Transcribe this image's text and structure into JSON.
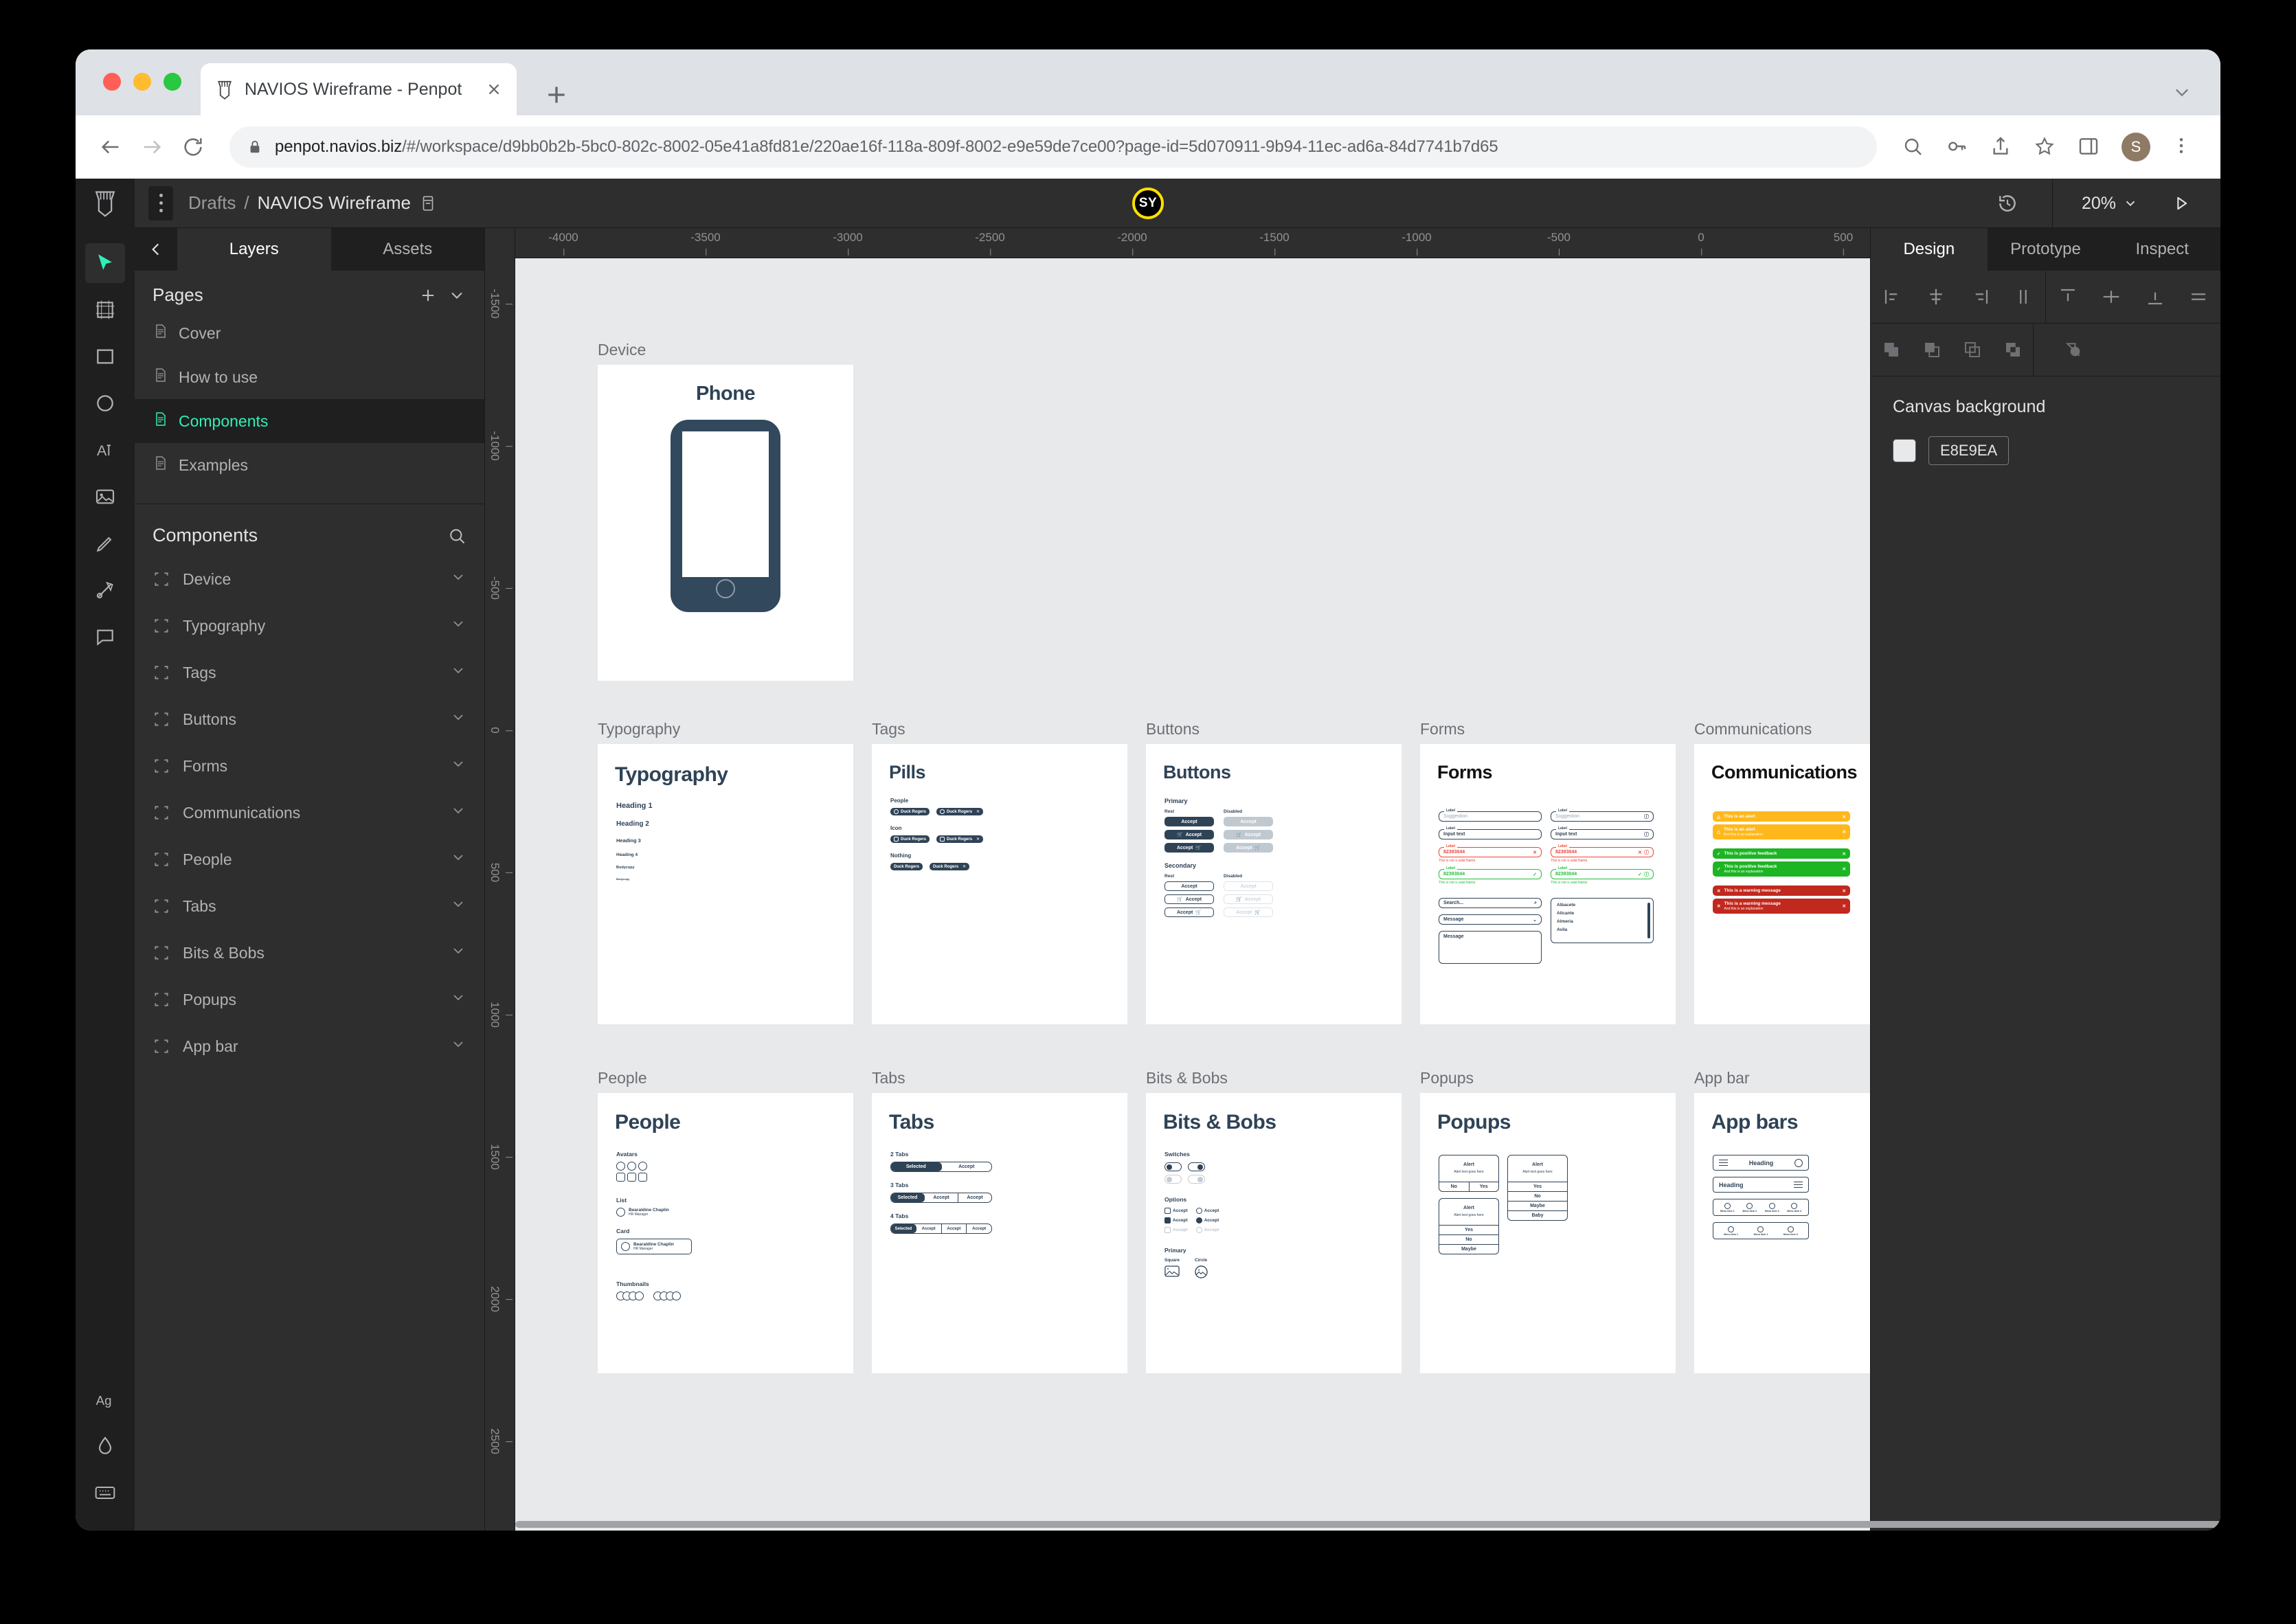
{
  "browser": {
    "tab_title": "NAVIOS Wireframe - Penpot",
    "url_host": "penpot.navios.biz",
    "url_path": "/#/workspace/d9bb0b2b-5bc0-802c-8002-05e41a8fd81e/220ae16f-118a-809f-8002-e9e59de7ce00?page-id=5d070911-9b94-11ec-ad6a-84d7741b7d65",
    "profile_initial": "S"
  },
  "header": {
    "breadcrumb_project": "Drafts",
    "breadcrumb_separator": "/",
    "breadcrumb_file": "NAVIOS Wireframe",
    "collaborator_initials": "SY",
    "zoom_level": "20%"
  },
  "left_panel": {
    "tabs": [
      {
        "label": "Layers",
        "active": true
      },
      {
        "label": "Assets",
        "active": false
      }
    ],
    "pages_title": "Pages",
    "pages": [
      {
        "label": "Cover",
        "selected": false
      },
      {
        "label": "How to use",
        "selected": false
      },
      {
        "label": "Components",
        "selected": true
      },
      {
        "label": "Examples",
        "selected": false
      }
    ],
    "components_title": "Components",
    "components": [
      {
        "label": "Device"
      },
      {
        "label": "Typography"
      },
      {
        "label": "Tags"
      },
      {
        "label": "Buttons"
      },
      {
        "label": "Forms"
      },
      {
        "label": "Communications"
      },
      {
        "label": "People"
      },
      {
        "label": "Tabs"
      },
      {
        "label": "Bits & Bobs"
      },
      {
        "label": "Popups"
      },
      {
        "label": "App bar"
      }
    ]
  },
  "right_panel": {
    "tabs": [
      {
        "label": "Design",
        "active": true
      },
      {
        "label": "Prototype",
        "active": false
      },
      {
        "label": "Inspect",
        "active": false
      }
    ],
    "canvas_background_label": "Canvas background",
    "canvas_background_hex": "E8E9EA"
  },
  "rulers": {
    "horizontal": [
      "-4000",
      "-3500",
      "-3000",
      "-2500",
      "-2000",
      "-1500",
      "-1000",
      "-500",
      "0",
      "500"
    ],
    "vertical": [
      "-1500",
      "-1000",
      "-500",
      "0",
      "500",
      "1000",
      "1500",
      "2000",
      "2500"
    ]
  },
  "canvas": {
    "boards": [
      {
        "label": "Device",
        "title": "Phone"
      },
      {
        "label": "Typography",
        "title": "Typography"
      },
      {
        "label": "Tags",
        "title": "Pills"
      },
      {
        "label": "Buttons",
        "title": "Buttons"
      },
      {
        "label": "Forms",
        "title": "Forms"
      },
      {
        "label": "Communications",
        "title": "Communications"
      },
      {
        "label": "People",
        "title": "People"
      },
      {
        "label": "Tabs",
        "title": "Tabs"
      },
      {
        "label": "Bits & Bobs",
        "title": "Bits & Bobs"
      },
      {
        "label": "Popups",
        "title": "Popups"
      },
      {
        "label": "App bar",
        "title": "App bars"
      }
    ],
    "typography_board": {
      "scale": [
        "Heading 1",
        "Heading 2",
        "Heading 3",
        "Heading 4",
        "Bodycopy",
        "Bodycopy"
      ]
    },
    "tags_board": {
      "groups": [
        "People",
        "Icon",
        "Nothing"
      ],
      "pill_label": "Duck Rogers"
    },
    "buttons_board": {
      "sections": [
        "Primary",
        "Secondary"
      ],
      "states": [
        "Rest",
        "Disabled"
      ],
      "button_label": "Accept"
    },
    "forms_board": {
      "field_label": "Label",
      "placeholder": "Suggestion",
      "input_value": "Input text",
      "number_value": "82393044",
      "error_helper": "This is not a valid Name",
      "success_helper": "This is not a valid Name",
      "search_placeholder": "Search...",
      "select_value": "Message",
      "textarea_value": "Message",
      "list_items": [
        "Albacete",
        "Alicante",
        "Almeria",
        "Avila"
      ]
    },
    "communications_board": {
      "alerts": [
        {
          "text": "This is an alert",
          "sub": "",
          "color": "#FFB81C"
        },
        {
          "text": "This is an alert",
          "sub": "And this is an explanation",
          "color": "#FFB81C"
        },
        {
          "text": "This is positive feedback",
          "sub": "",
          "color": "#1DB524"
        },
        {
          "text": "This is positive feedback",
          "sub": "And this is an explanation",
          "color": "#1DB524"
        },
        {
          "text": "This is a warning message",
          "sub": "",
          "color": "#C1291E"
        },
        {
          "text": "This is a warning message",
          "sub": "And this is an explanation",
          "color": "#C1291E"
        }
      ]
    },
    "people_board": {
      "groups": [
        "Avatars",
        "List",
        "Card",
        "Thumbnails"
      ],
      "person_name": "Bearaldine Chaplin",
      "person_role": "HR Manager"
    },
    "tabs_board": {
      "groups": [
        "2 Tabs",
        "3 Tabs",
        "4 Tabs"
      ],
      "selected_label": "Selected",
      "tab_label": "Accept"
    },
    "bits_board": {
      "groups": [
        "Switches",
        "Options",
        "Primary"
      ],
      "option_label": "Accept",
      "shapes": [
        "Square",
        "Circle"
      ]
    },
    "popups_board": {
      "alert_title": "Alert",
      "alert_body": "Alert text goes here",
      "actions_a": [
        "No",
        "Yes"
      ],
      "actions_b": [
        "Yes",
        "No",
        "Maybe"
      ],
      "actions_c": [
        "Yes",
        "No",
        "Maybe",
        "Baby"
      ]
    },
    "appbar_board": {
      "heading": "Heading",
      "menu_items_4": [
        "Menu item 1",
        "Menu item 2",
        "Menu item 3",
        "Menu item 4"
      ],
      "menu_items_3": [
        "Menu item 1",
        "Menu item 2",
        "Menu item 3"
      ]
    }
  }
}
